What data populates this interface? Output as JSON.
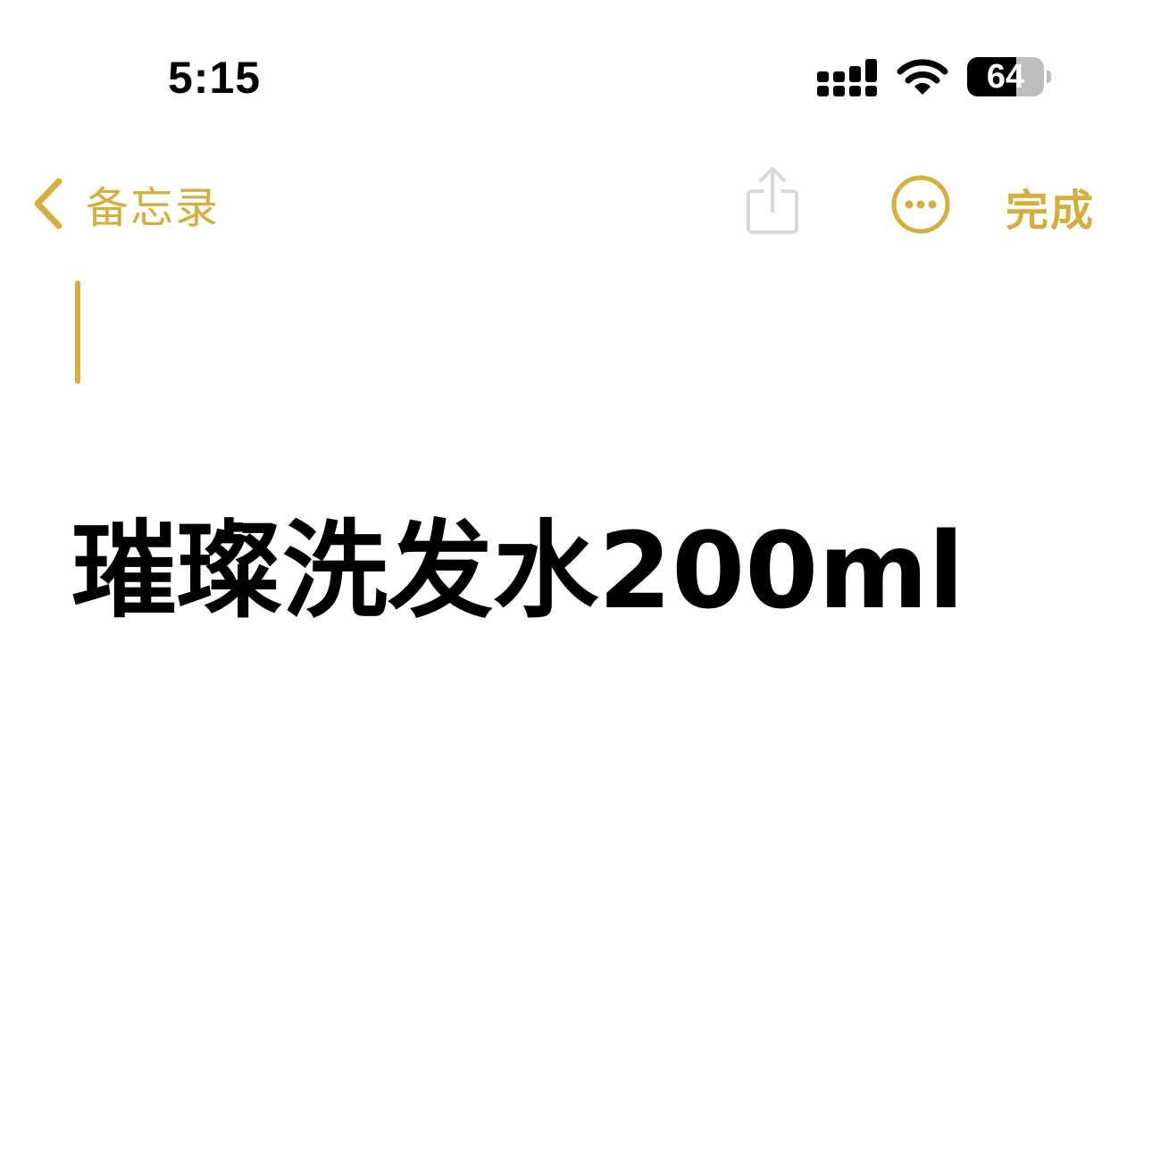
{
  "status_bar": {
    "time": "5:15",
    "battery_level": "64",
    "battery_fraction": 0.64,
    "icons": [
      "cellular-signal-icon",
      "wifi-icon",
      "battery-icon"
    ]
  },
  "nav": {
    "back_label": "备忘录",
    "done_label": "完成",
    "icons": [
      "chevron-left-icon",
      "share-icon",
      "more-icon"
    ]
  },
  "note": {
    "title": "璀璨洗发水200ml"
  },
  "colors": {
    "accent": "#D6AE3C",
    "share_disabled": "#D9D9D9",
    "text": "#000000",
    "background": "#FFFFFF"
  }
}
